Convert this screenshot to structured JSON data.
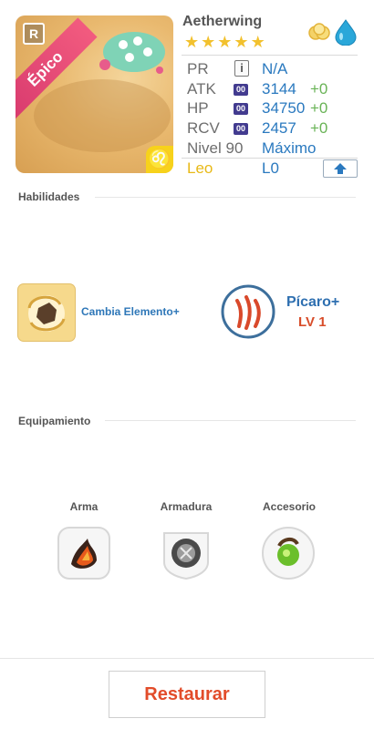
{
  "character": {
    "rarity_label": "Épico",
    "rarity_badge": "R",
    "zodiac_glyph": "♌",
    "name": "Aetherwing",
    "stars": 5,
    "elements": [
      "light-icon",
      "water-drop-icon"
    ]
  },
  "stats": {
    "pr": {
      "label": "PR",
      "value": "N/A"
    },
    "atk": {
      "label": "ATK",
      "badge": "00",
      "value": "3144",
      "bonus": "+0"
    },
    "hp": {
      "label": "HP",
      "badge": "00",
      "value": "34750",
      "bonus": "+0"
    },
    "rcv": {
      "label": "RCV",
      "badge": "00",
      "value": "2457",
      "bonus": "+0"
    },
    "level": {
      "label": "Nivel 90",
      "value": "Máximo"
    },
    "sign": {
      "label": "Leo",
      "value": "L0"
    }
  },
  "abilities": {
    "title": "Habilidades",
    "skill_label": "Cambia Elemento+",
    "leader_name": "Pícaro+",
    "leader_level": "LV 1"
  },
  "equipment": {
    "title": "Equipamiento",
    "slots": [
      {
        "label": "Arma"
      },
      {
        "label": "Armadura"
      },
      {
        "label": "Accesorio"
      }
    ]
  },
  "footer": {
    "restore_label": "Restaurar"
  },
  "colors": {
    "accent_blue": "#2a79bf",
    "bonus_green": "#69b356",
    "restore_red": "#e24c2a",
    "leo_gold": "#e8b917"
  }
}
